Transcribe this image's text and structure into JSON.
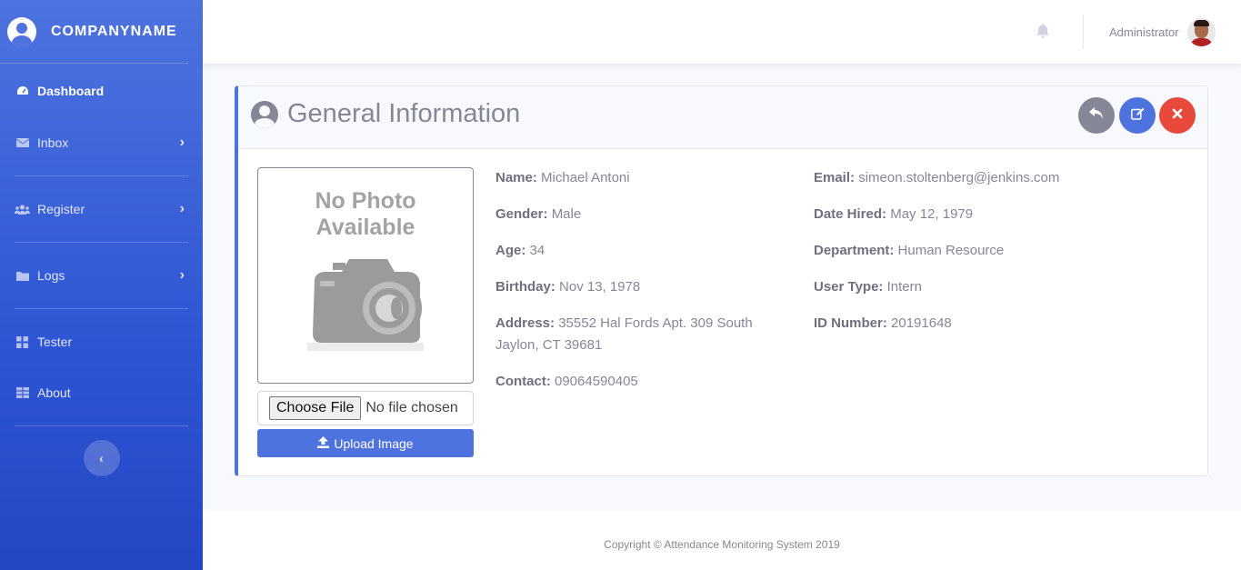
{
  "brand": {
    "name": "COMPANYNAME",
    "icon": "user-circle-icon"
  },
  "sidebar": {
    "items": [
      {
        "label": "Dashboard",
        "icon": "tachometer-icon",
        "active": true
      },
      {
        "label": "Inbox",
        "icon": "envelope-icon",
        "has_submenu": true
      },
      {
        "label": "Register",
        "icon": "users-icon",
        "has_submenu": true
      },
      {
        "label": "Logs",
        "icon": "folder-icon",
        "has_submenu": true
      },
      {
        "label": "Tester",
        "icon": "grid-icon"
      },
      {
        "label": "About",
        "icon": "table-icon"
      }
    ],
    "toggle_icon": "chevron-left-icon"
  },
  "topbar": {
    "user_name": "Administrator",
    "notification_icon": "bell-icon"
  },
  "card": {
    "title": "General Information",
    "actions": [
      {
        "name": "back",
        "icon": "reply-icon",
        "color": "#858796"
      },
      {
        "name": "edit",
        "icon": "edit-icon",
        "color": "#4e73df"
      },
      {
        "name": "delete",
        "icon": "close-icon",
        "color": "#e74a3b"
      }
    ],
    "photo": {
      "placeholder_line1": "No Photo",
      "placeholder_line2": "Available"
    },
    "file_input": {
      "button": "Choose File",
      "status": "No file chosen"
    },
    "upload_label": "Upload Image",
    "fields_left": [
      {
        "label": "Name:",
        "value": "Michael Antoni"
      },
      {
        "label": "Gender:",
        "value": "Male"
      },
      {
        "label": "Age:",
        "value": "34"
      },
      {
        "label": "Birthday:",
        "value": "Nov 13, 1978"
      },
      {
        "label": "Address:",
        "value": "35552 Hal Fords Apt. 309 South Jaylon, CT 39681"
      },
      {
        "label": "Contact:",
        "value": "09064590405"
      }
    ],
    "fields_right": [
      {
        "label": "Email:",
        "value": "simeon.stoltenberg@jenkins.com"
      },
      {
        "label": "Date Hired:",
        "value": "May 12, 1979"
      },
      {
        "label": "Department:",
        "value": "Human Resource"
      },
      {
        "label": "User Type:",
        "value": "Intern"
      },
      {
        "label": "ID Number:",
        "value": "20191648"
      }
    ]
  },
  "footer": {
    "copyright": "Copyright © Attendance Monitoring System 2019"
  },
  "colors": {
    "primary": "#4e73df",
    "danger": "#e74a3b",
    "secondary": "#858796"
  }
}
